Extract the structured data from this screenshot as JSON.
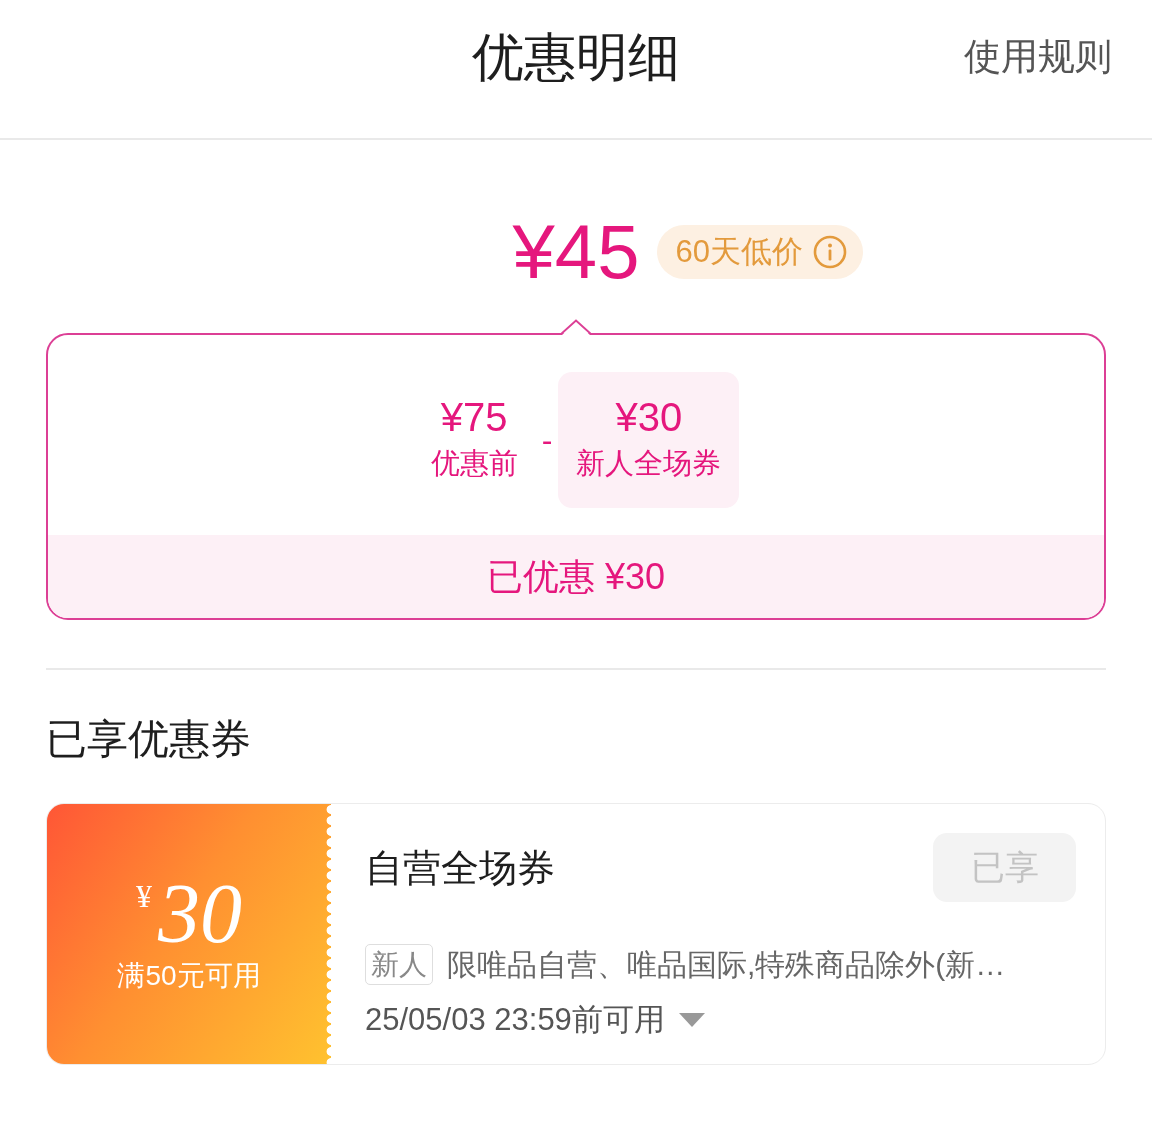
{
  "header": {
    "title": "优惠明细",
    "rules_link": "使用规则"
  },
  "price": {
    "final": "¥45",
    "badge": "60天低价"
  },
  "breakdown": {
    "items": [
      {
        "kind": "price",
        "amount": "¥75",
        "label": "优惠前"
      },
      {
        "kind": "coupon",
        "amount": "¥30",
        "label": "新人全场券"
      }
    ],
    "operator": "-",
    "total": "已优惠 ¥30"
  },
  "coupons_section": {
    "title": "已享优惠券",
    "coupons": [
      {
        "currency": "¥",
        "amount": "30",
        "condition": "满50元可用",
        "name": "自营全场券",
        "button": {
          "label": "已享",
          "disabled": true
        },
        "tag": "新人",
        "description": "限唯品自营、唯品国际,特殊商品除外(新…",
        "validity": "25/05/03 23:59前可用"
      }
    ]
  }
}
